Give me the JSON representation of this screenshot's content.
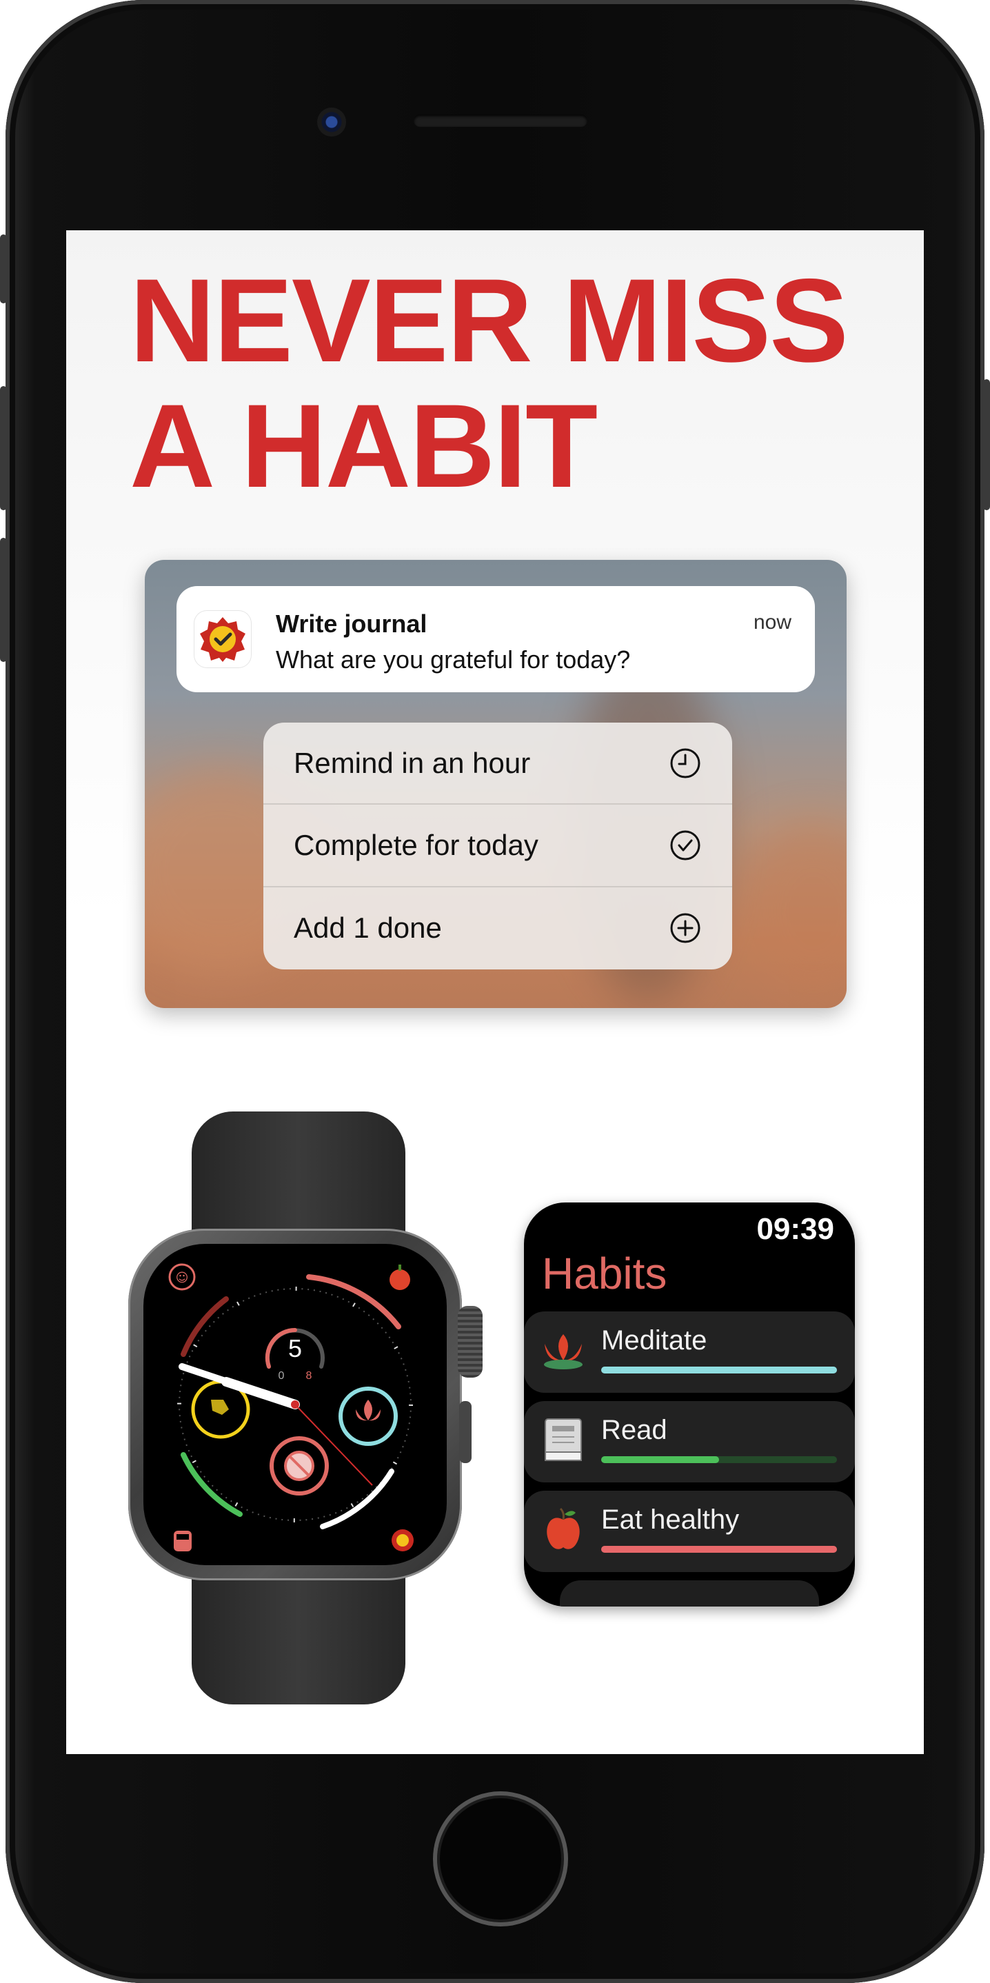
{
  "headline": {
    "line1": "NEVER MISS",
    "line2": "A HABIT"
  },
  "notification": {
    "title": "Write journal",
    "body": "What are you grateful for today?",
    "time": "now",
    "icon": "badge-check-icon"
  },
  "actions": [
    {
      "label": "Remind in an hour",
      "icon": "clock-icon"
    },
    {
      "label": "Complete for today",
      "icon": "checkmark-circle-icon"
    },
    {
      "label": "Add 1 done",
      "icon": "plus-circle-icon"
    }
  ],
  "watch_face": {
    "complication_value": "5",
    "complication_min": "0",
    "complication_max": "8"
  },
  "watch_app": {
    "time": "09:39",
    "title": "Habits",
    "habits": [
      {
        "name": "Meditate",
        "icon": "lotus-icon",
        "progress": 1.0,
        "color": "#8fdde0"
      },
      {
        "name": "Read",
        "icon": "book-icon",
        "progress": 0.5,
        "color": "#4cc05a"
      },
      {
        "name": "Eat healthy",
        "icon": "apple-icon",
        "progress": 1.0,
        "color": "#e8686a"
      }
    ]
  },
  "colors": {
    "headline": "#d12c2c",
    "habits_title": "#e06a64"
  }
}
